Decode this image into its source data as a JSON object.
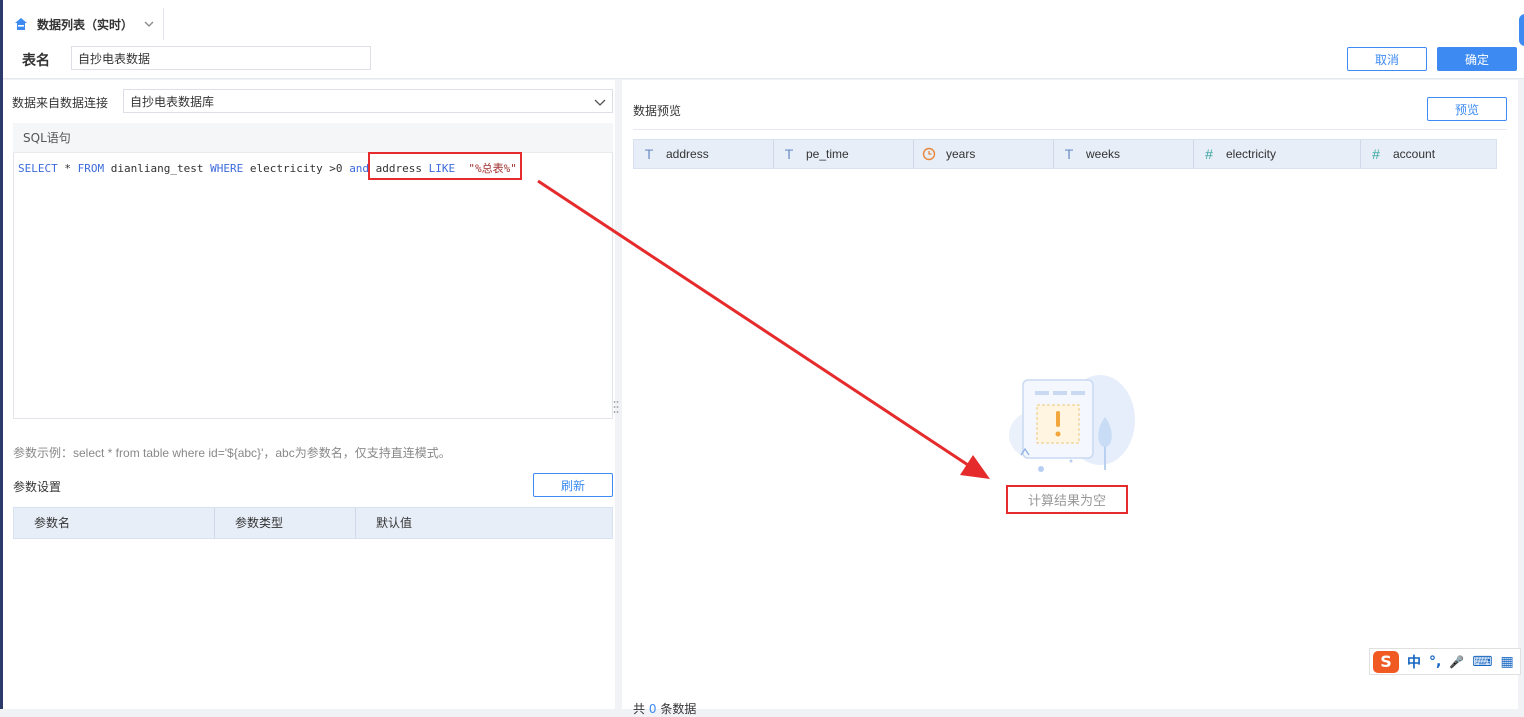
{
  "tab": {
    "title": "数据列表（实时）"
  },
  "header": {
    "table_name_label": "表名",
    "table_name_value": "自抄电表数据",
    "cancel_label": "取消",
    "confirm_label": "确定"
  },
  "datasource": {
    "label": "数据来自数据连接",
    "selected": "自抄电表数据库"
  },
  "sql": {
    "title": "SQL语句",
    "tokens": {
      "t1": "SELECT",
      "t2": " * ",
      "t3": "FROM",
      "t4": " dianliang_test ",
      "t5": "WHERE",
      "t6": " electricity >0 ",
      "t7": "and",
      "t8": " address ",
      "t9": "LIKE",
      "t10": "  ",
      "t11": "\"%总表%\""
    }
  },
  "params": {
    "hint": "参数示例：select * from table where id='${abc}'，abc为参数名，仅支持直连模式。",
    "title": "参数设置",
    "refresh_label": "刷新",
    "columns": [
      "参数名",
      "参数类型",
      "默认值"
    ]
  },
  "preview": {
    "title": "数据预览",
    "button_label": "预览",
    "columns": [
      {
        "name": "address",
        "type_icon": "T"
      },
      {
        "name": "pe_time",
        "type_icon": "T"
      },
      {
        "name": "years",
        "type_icon": "clock-icon"
      },
      {
        "name": "weeks",
        "type_icon": "T"
      },
      {
        "name": "electricity",
        "type_icon": "#"
      },
      {
        "name": "account",
        "type_icon": "#"
      }
    ],
    "empty_text": "计算结果为空",
    "total_prefix": "共",
    "total_count": "0",
    "total_suffix": "条数据"
  },
  "ime": {
    "logo": "S",
    "items": [
      "中",
      "°,",
      "🎤",
      "⌨",
      "▦"
    ]
  },
  "colors": {
    "accent": "#3d8bf2",
    "highlight": "#e52b2b"
  }
}
